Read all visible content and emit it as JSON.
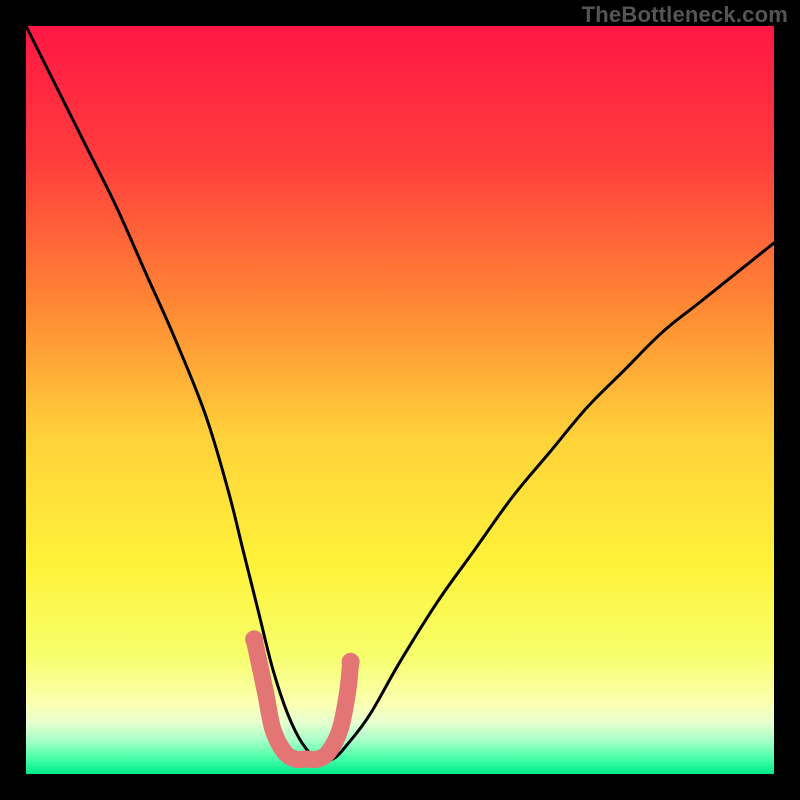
{
  "watermark": "TheBottleneck.com",
  "chart_data": {
    "type": "line",
    "title": "",
    "xlabel": "",
    "ylabel": "",
    "xlim": [
      0,
      100
    ],
    "ylim": [
      0,
      100
    ],
    "x": [
      0,
      4,
      8,
      12,
      16,
      20,
      24,
      27,
      29,
      31,
      33,
      35,
      37,
      39,
      41,
      43,
      46,
      50,
      55,
      60,
      65,
      70,
      75,
      80,
      85,
      90,
      95,
      100
    ],
    "values": [
      100,
      92,
      84,
      76,
      67,
      58,
      48,
      38,
      30,
      22,
      14,
      8,
      4,
      2,
      2,
      4,
      8,
      15,
      23,
      30,
      37,
      43,
      49,
      54,
      59,
      63,
      67,
      71
    ],
    "gradient_stops": [
      {
        "offset": 0.0,
        "color": "#ff1744"
      },
      {
        "offset": 0.18,
        "color": "#ff3d3d"
      },
      {
        "offset": 0.38,
        "color": "#ff8a34"
      },
      {
        "offset": 0.55,
        "color": "#ffd23a"
      },
      {
        "offset": 0.72,
        "color": "#fff23a"
      },
      {
        "offset": 0.84,
        "color": "#f6ff6a"
      },
      {
        "offset": 0.905,
        "color": "#fcffb0"
      },
      {
        "offset": 0.93,
        "color": "#e8ffd0"
      },
      {
        "offset": 0.955,
        "color": "#a8ffc8"
      },
      {
        "offset": 0.98,
        "color": "#45ffa8"
      },
      {
        "offset": 1.0,
        "color": "#00e98a"
      }
    ],
    "highlight": {
      "color": "#e37575",
      "x": [
        30.5,
        32,
        33,
        34.5,
        36,
        37.5,
        39,
        40.5,
        42,
        43,
        43.4
      ],
      "values": [
        18,
        11,
        6,
        3,
        2,
        2,
        2,
        3,
        6,
        11,
        15
      ]
    }
  }
}
